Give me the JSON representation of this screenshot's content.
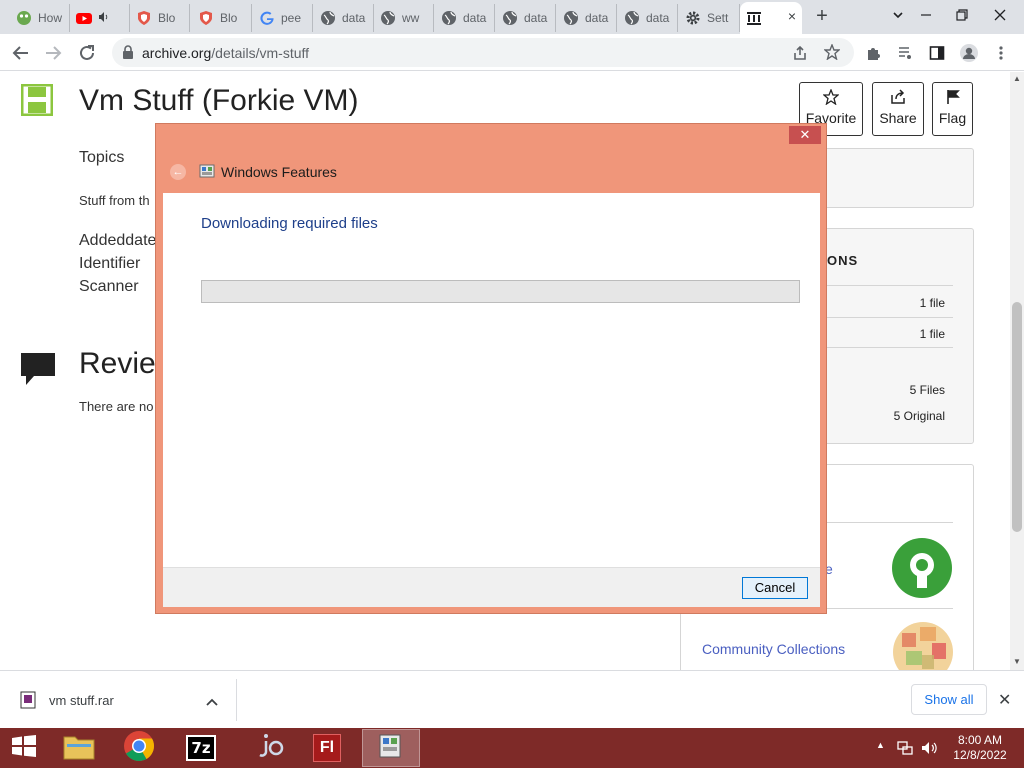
{
  "browser": {
    "tabs": [
      {
        "label": "How",
        "icon": "frog-icon"
      },
      {
        "label": "",
        "icon": "youtube-icon"
      },
      {
        "label": "Blo",
        "icon": "shield-icon"
      },
      {
        "label": "Blo",
        "icon": "shield-icon"
      },
      {
        "label": "pee",
        "icon": "google-icon"
      },
      {
        "label": "data",
        "icon": "globe-icon"
      },
      {
        "label": "ww",
        "icon": "globe-icon"
      },
      {
        "label": "data",
        "icon": "globe-icon"
      },
      {
        "label": "data",
        "icon": "globe-icon"
      },
      {
        "label": "data",
        "icon": "globe-icon"
      },
      {
        "label": "data",
        "icon": "globe-icon"
      },
      {
        "label": "Sett",
        "icon": "gear-icon"
      }
    ],
    "active_tab": {
      "label": "",
      "icon": "archive-icon",
      "close": "×"
    },
    "new_tab": "+",
    "url_host": "archive.org",
    "url_path": "/details/vm-stuff"
  },
  "page": {
    "title": "Vm Stuff (Forkie VM)",
    "topics_label": "Topics",
    "description": "Stuff from th",
    "addeddate_label": "Addeddate",
    "identifier_label": "Identifier",
    "scanner_label": "Scanner",
    "reviews_heading": "Revie",
    "reviews_text": "There are no",
    "buttons": {
      "favorite": "Favorite",
      "share": "Share",
      "flag": "Flag"
    },
    "downloads_heading": "ONS",
    "downloads": [
      "1 file",
      "1 file",
      "5 Files",
      "5 Original"
    ],
    "collections_link_fragment": "e",
    "community_collections": "Community Collections"
  },
  "dialog": {
    "title": "Windows Features",
    "heading": "Downloading required files",
    "progress": 0,
    "cancel_label": "Cancel",
    "close_glyph": "✕",
    "back_glyph": "←"
  },
  "download_shelf": {
    "file_name": "vm stuff.rar",
    "show_all": "Show all",
    "close": "✕",
    "chevron": "^"
  },
  "taskbar": {
    "time": "8:00 AM",
    "date": "12/8/2022",
    "items": [
      "file-explorer",
      "chrome",
      "7-zip",
      "jio",
      "flash",
      "windows-features"
    ],
    "flash_label": "Fl",
    "sevenzip_label": "7z"
  },
  "colors": {
    "dialog_frame": "#f0967a",
    "taskbar": "#7e2a28",
    "link": "#4a5fc1",
    "heading_blue": "#1e3f8a"
  }
}
